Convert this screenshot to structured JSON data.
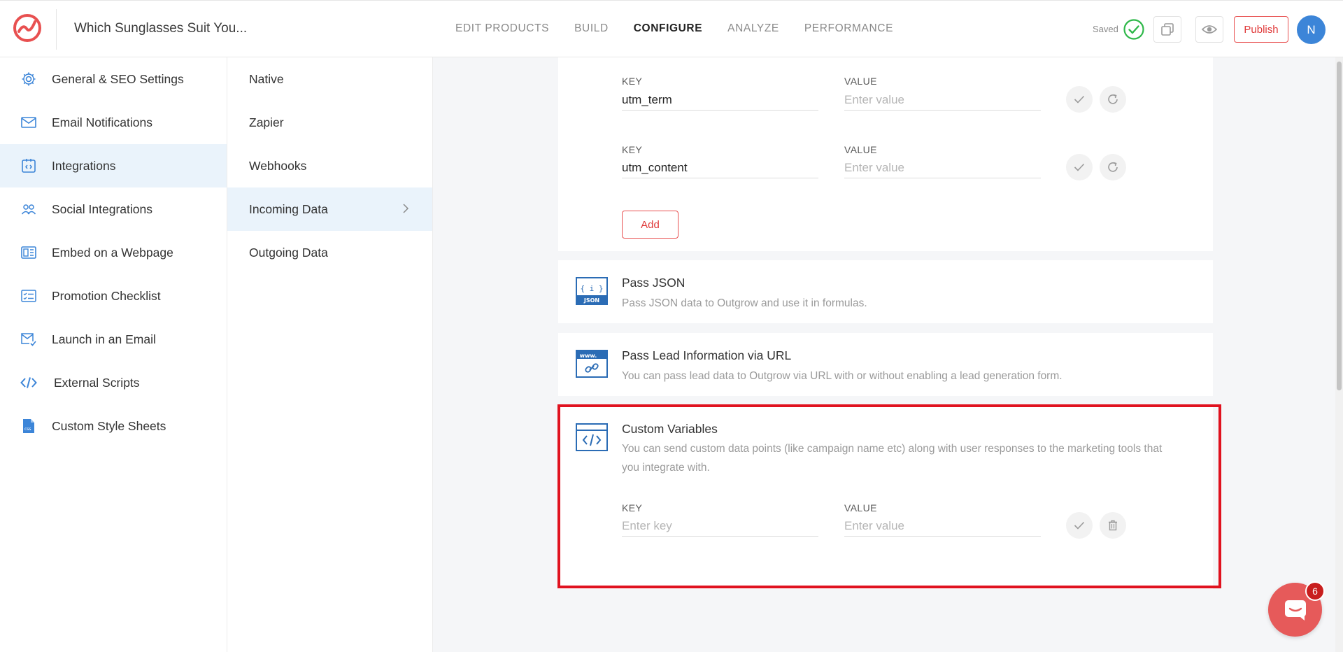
{
  "header": {
    "title": "Which Sunglasses Suit You...",
    "nav": [
      "EDIT PRODUCTS",
      "BUILD",
      "CONFIGURE",
      "ANALYZE",
      "PERFORMANCE"
    ],
    "active_nav": "CONFIGURE",
    "saved_label": "Saved",
    "publish_label": "Publish",
    "avatar_initial": "N"
  },
  "sidebar": {
    "items": [
      {
        "label": "General & SEO Settings",
        "icon": "gear-icon"
      },
      {
        "label": "Email Notifications",
        "icon": "envelope-icon"
      },
      {
        "label": "Integrations",
        "icon": "integrations-icon",
        "active": true
      },
      {
        "label": "Social Integrations",
        "icon": "users-icon"
      },
      {
        "label": "Embed on a Webpage",
        "icon": "embed-icon"
      },
      {
        "label": "Promotion Checklist",
        "icon": "checklist-icon"
      },
      {
        "label": "Launch in an Email",
        "icon": "email-launch-icon"
      },
      {
        "label": "External Scripts",
        "icon": "code-icon"
      },
      {
        "label": "Custom Style Sheets",
        "icon": "css-file-icon"
      }
    ]
  },
  "subnav": {
    "items": [
      {
        "label": "Native"
      },
      {
        "label": "Zapier"
      },
      {
        "label": "Webhooks"
      },
      {
        "label": "Incoming Data",
        "active": true
      },
      {
        "label": "Outgoing Data"
      }
    ]
  },
  "utm": {
    "key_label": "KEY",
    "value_label": "VALUE",
    "rows": [
      {
        "key": "utm_term",
        "value_placeholder": "Enter value"
      },
      {
        "key": "utm_content",
        "value_placeholder": "Enter value"
      }
    ],
    "add_label": "Add"
  },
  "pass_json": {
    "title": "Pass JSON",
    "desc": "Pass JSON data to Outgrow and use it in formulas.",
    "icon_text_top": "{ i }",
    "icon_text_bottom": "JSON"
  },
  "pass_lead": {
    "title": "Pass Lead Information via URL",
    "desc": "You can pass lead data to Outgrow via URL with or without enabling a lead generation form.",
    "icon_text": "www."
  },
  "custom_vars": {
    "title": "Custom Variables",
    "desc": "You can send custom data points (like campaign name etc) along with user responses to the marketing tools that you integrate with.",
    "key_label": "KEY",
    "value_label": "VALUE",
    "key_placeholder": "Enter key",
    "value_placeholder": "Enter value"
  },
  "chat": {
    "badge_count": "6"
  },
  "colors": {
    "accent_blue": "#3c85d8",
    "accent_red": "#e03a3a",
    "highlight": "#e0121f",
    "active_bg": "#eaf3fb"
  }
}
